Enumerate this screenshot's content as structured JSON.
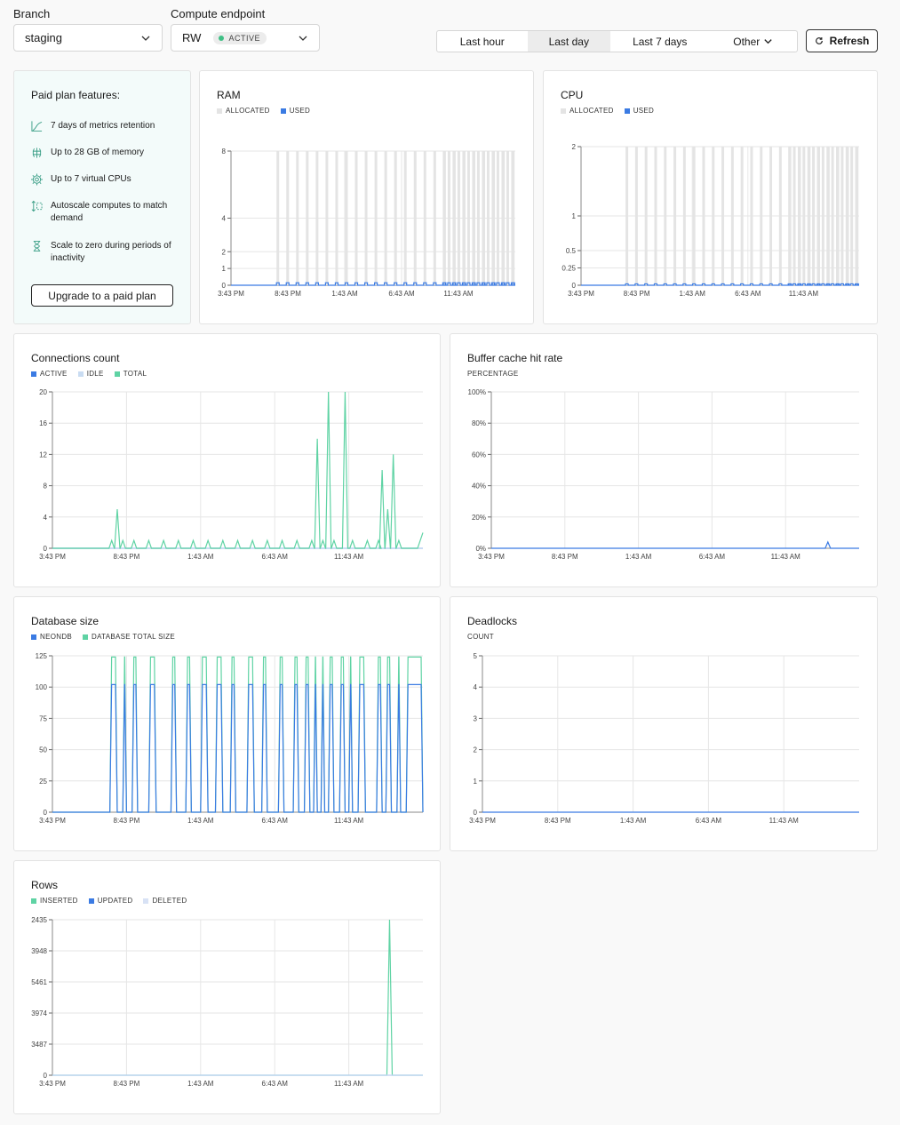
{
  "controls": {
    "branch_label": "Branch",
    "branch_value": "staging",
    "endpoint_label": "Compute endpoint",
    "endpoint_value": "RW",
    "endpoint_status": "ACTIVE",
    "ranges": [
      "Last hour",
      "Last day",
      "Last 7 days",
      "Other"
    ],
    "selected_range": "Last day",
    "refresh_label": "Refresh"
  },
  "promo": {
    "title": "Paid plan features:",
    "features": [
      {
        "text": "7 days of metrics retention",
        "icon": "chart-line-icon"
      },
      {
        "text": "Up to 28 GB of memory",
        "icon": "memory-icon"
      },
      {
        "text": "Up to 7 virtual CPUs",
        "icon": "cpu-icon"
      },
      {
        "text": "Autoscale computes to match demand",
        "icon": "autoscale-icon"
      },
      {
        "text": "Scale to zero during periods of inactivity",
        "icon": "hourglass-icon"
      }
    ],
    "button": "Upgrade to a paid plan"
  },
  "colors": {
    "blue": "#3b7be3",
    "green": "#5fd3a4",
    "lightgray": "#e4e4e4",
    "idle": "#c9dcf2",
    "deleted": "#d8e2f5"
  },
  "chart_data": [
    {
      "id": "ram",
      "type": "area",
      "title": "RAM",
      "xticks": [
        "3:43 PM",
        "8:43 PM",
        "1:43 AM",
        "6:43 AM",
        "11:43 AM"
      ],
      "yticks": [
        {
          "v": 0,
          "label": "0"
        },
        {
          "v": 1,
          "label": "1"
        },
        {
          "v": 2,
          "label": "2"
        },
        {
          "v": 4,
          "label": "4"
        },
        {
          "v": 8,
          "label": "8"
        }
      ],
      "ylim": [
        0,
        8
      ],
      "series": [
        {
          "name": "ALLOCATED",
          "color": "#e4e4e4",
          "kind": "bars",
          "value": 8
        },
        {
          "name": "USED",
          "color": "#3b7be3",
          "kind": "line",
          "value": 0.15
        }
      ]
    },
    {
      "id": "cpu",
      "type": "area",
      "title": "CPU",
      "xticks": [
        "3:43 PM",
        "8:43 PM",
        "1:43 AM",
        "6:43 AM",
        "11:43 AM"
      ],
      "yticks": [
        {
          "v": 0,
          "label": "0"
        },
        {
          "v": 0.25,
          "label": "0.25"
        },
        {
          "v": 0.5,
          "label": "0.5"
        },
        {
          "v": 1,
          "label": "1"
        },
        {
          "v": 2,
          "label": "2"
        }
      ],
      "ylim": [
        0,
        2
      ],
      "series": [
        {
          "name": "ALLOCATED",
          "color": "#e4e4e4",
          "kind": "bars",
          "value": 2
        },
        {
          "name": "USED",
          "color": "#3b7be3",
          "kind": "line",
          "value": 0.02
        }
      ]
    },
    {
      "id": "connections",
      "type": "line",
      "title": "Connections count",
      "xticks": [
        "3:43 PM",
        "8:43 PM",
        "1:43 AM",
        "6:43 AM",
        "11:43 AM"
      ],
      "yticks": [
        {
          "v": 0,
          "label": "0"
        },
        {
          "v": 4,
          "label": "4"
        },
        {
          "v": 8,
          "label": "8"
        },
        {
          "v": 12,
          "label": "12"
        },
        {
          "v": 16,
          "label": "16"
        },
        {
          "v": 20,
          "label": "20"
        }
      ],
      "ylim": [
        0,
        20
      ],
      "series": [
        {
          "name": "ACTIVE",
          "color": "#3b7be3"
        },
        {
          "name": "IDLE",
          "color": "#c9dcf2"
        },
        {
          "name": "TOTAL",
          "color": "#5fd3a4",
          "spikes": [
            [
              0.16,
              1
            ],
            [
              0.175,
              5
            ],
            [
              0.19,
              1
            ],
            [
              0.22,
              1
            ],
            [
              0.26,
              1
            ],
            [
              0.3,
              1
            ],
            [
              0.34,
              1
            ],
            [
              0.38,
              1
            ],
            [
              0.42,
              1
            ],
            [
              0.46,
              1
            ],
            [
              0.5,
              1
            ],
            [
              0.54,
              1
            ],
            [
              0.58,
              1
            ],
            [
              0.62,
              1
            ],
            [
              0.66,
              1
            ],
            [
              0.7,
              1
            ],
            [
              0.715,
              14
            ],
            [
              0.73,
              1
            ],
            [
              0.745,
              20
            ],
            [
              0.76,
              1
            ],
            [
              0.79,
              20
            ],
            [
              0.81,
              1
            ],
            [
              0.85,
              1
            ],
            [
              0.88,
              1
            ],
            [
              0.89,
              10
            ],
            [
              0.905,
              5
            ],
            [
              0.92,
              12
            ],
            [
              0.935,
              1
            ]
          ]
        }
      ]
    },
    {
      "id": "buffer",
      "type": "line",
      "title": "Buffer cache hit rate",
      "xticks": [
        "3:43 PM",
        "8:43 PM",
        "1:43 AM",
        "6:43 AM",
        "11:43 AM"
      ],
      "yticks": [
        {
          "v": 0,
          "label": "0%"
        },
        {
          "v": 20,
          "label": "20%"
        },
        {
          "v": 40,
          "label": "40%"
        },
        {
          "v": 60,
          "label": "60%"
        },
        {
          "v": 80,
          "label": "80%"
        },
        {
          "v": 100,
          "label": "100%"
        }
      ],
      "ylim": [
        0,
        100
      ],
      "series": [
        {
          "name": "PERCENTAGE",
          "color": "#3b7be3",
          "spikes": [
            [
              0.915,
              4
            ]
          ]
        }
      ]
    },
    {
      "id": "dbsize",
      "type": "line",
      "title": "Database size",
      "xticks": [
        "3:43 PM",
        "8:43 PM",
        "1:43 AM",
        "6:43 AM",
        "11:43 AM"
      ],
      "yticks": [
        {
          "v": 0,
          "label": "0"
        },
        {
          "v": 25,
          "label": "25"
        },
        {
          "v": 50,
          "label": "50"
        },
        {
          "v": 75,
          "label": "75"
        },
        {
          "v": 100,
          "label": "100"
        },
        {
          "v": 125,
          "label": "125"
        }
      ],
      "ylim": [
        0,
        125
      ],
      "series": [
        {
          "name": "NEONDB",
          "color": "#3b7be3",
          "value": 102
        },
        {
          "name": "DATABASE TOTAL SIZE",
          "color": "#5fd3a4",
          "value": 124
        }
      ],
      "on_windows": [
        [
          0.155,
          0.175
        ],
        [
          0.19,
          0.2
        ],
        [
          0.215,
          0.23
        ],
        [
          0.26,
          0.28
        ],
        [
          0.32,
          0.335
        ],
        [
          0.36,
          0.375
        ],
        [
          0.4,
          0.42
        ],
        [
          0.44,
          0.46
        ],
        [
          0.48,
          0.495
        ],
        [
          0.525,
          0.545
        ],
        [
          0.565,
          0.58
        ],
        [
          0.61,
          0.625
        ],
        [
          0.65,
          0.665
        ],
        [
          0.68,
          0.695
        ],
        [
          0.705,
          0.715
        ],
        [
          0.725,
          0.735
        ],
        [
          0.745,
          0.76
        ],
        [
          0.775,
          0.79
        ],
        [
          0.8,
          0.81
        ],
        [
          0.825,
          0.845
        ],
        [
          0.875,
          0.89
        ],
        [
          0.9,
          0.915
        ],
        [
          0.93,
          0.94
        ],
        [
          0.955,
          1.0
        ]
      ]
    },
    {
      "id": "deadlocks",
      "type": "line",
      "title": "Deadlocks",
      "xticks": [
        "3:43 PM",
        "8:43 PM",
        "1:43 AM",
        "6:43 AM",
        "11:43 AM"
      ],
      "yticks": [
        {
          "v": 0,
          "label": "0"
        },
        {
          "v": 1,
          "label": "1"
        },
        {
          "v": 2,
          "label": "2"
        },
        {
          "v": 3,
          "label": "3"
        },
        {
          "v": 4,
          "label": "4"
        },
        {
          "v": 5,
          "label": "5"
        }
      ],
      "ylim": [
        0,
        5
      ],
      "series": [
        {
          "name": "COUNT",
          "color": "#3b7be3"
        }
      ]
    },
    {
      "id": "rows",
      "type": "line",
      "title": "Rows",
      "xticks": [
        "3:43 PM",
        "8:43 PM",
        "1:43 AM",
        "6:43 AM",
        "11:43 AM"
      ],
      "yticks": [
        {
          "v": 0,
          "label": "0"
        },
        {
          "v": 1,
          "label": "3487"
        },
        {
          "v": 2,
          "label": "3974"
        },
        {
          "v": 3,
          "label": "5461"
        },
        {
          "v": 4,
          "label": "3948"
        },
        {
          "v": 5,
          "label": "2435"
        }
      ],
      "ylim": [
        0,
        5
      ],
      "series": [
        {
          "name": "INSERTED",
          "color": "#5fd3a4",
          "spikes": [
            [
              0.91,
              5
            ]
          ]
        },
        {
          "name": "UPDATED",
          "color": "#3b7be3"
        },
        {
          "name": "DELETED",
          "color": "#d8e2f5"
        }
      ]
    }
  ]
}
